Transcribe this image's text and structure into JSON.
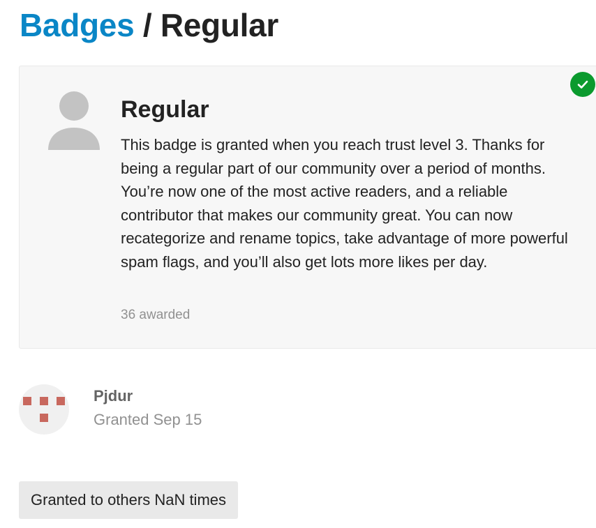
{
  "header": {
    "breadcrumb_link": "Badges",
    "separator": " / ",
    "current": "Regular"
  },
  "badge": {
    "icon": "user-silhouette-icon",
    "earned_icon": "checkmark-icon",
    "earned_color": "#0b9a2e",
    "name": "Regular",
    "description": "This badge is granted when you reach trust level 3. Thanks for being a regular part of our community over a period of months. You’re now one of the most active readers, and a reliable contributor that makes our community great. You can now recategorize and rename topics, take advantage of more powerful spam flags, and you’ll also get lots more likes per day.",
    "awarded": "36 awarded"
  },
  "grants": [
    {
      "username": "Pjdur",
      "granted": "Granted Sep 15",
      "avatar_color": "#c8685e"
    }
  ],
  "more_button": {
    "label": "Granted to others NaN times"
  },
  "colors": {
    "link": "#0a86c6",
    "card_background": "#f7f7f7"
  }
}
